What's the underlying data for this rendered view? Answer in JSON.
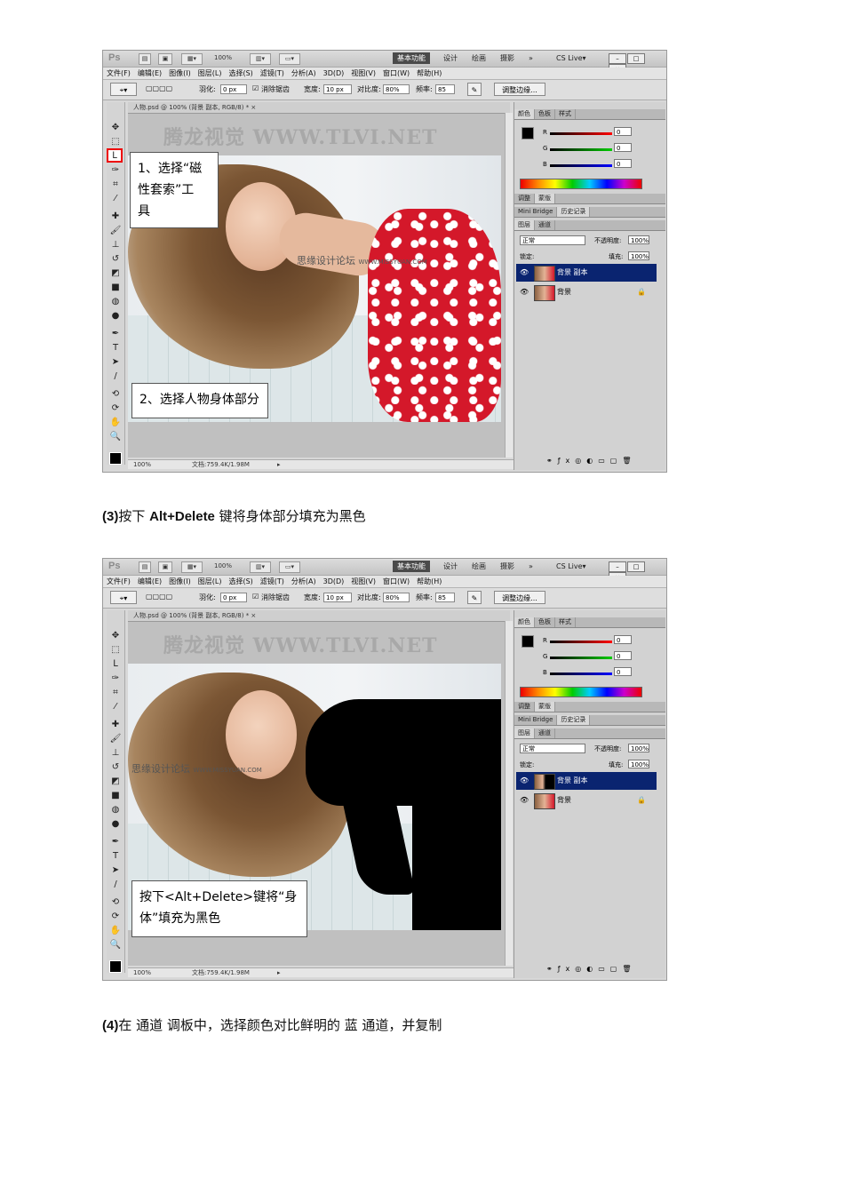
{
  "app": {
    "logo": "Ps",
    "zoom": "100%",
    "workspaces": [
      "基本功能",
      "设计",
      "绘画",
      "摄影",
      "»"
    ],
    "cs_live": "CS Live▾",
    "menu": [
      "文件(F)",
      "编辑(E)",
      "图像(I)",
      "图层(L)",
      "选择(S)",
      "滤镜(T)",
      "分析(A)",
      "3D(D)",
      "视图(V)",
      "窗口(W)",
      "帮助(H)"
    ],
    "options": {
      "feather_label": "羽化:",
      "feather_value": "0 px",
      "antialias_label": "消除锯齿",
      "width_label": "宽度:",
      "width_value": "10 px",
      "contrast_label": "对比度:",
      "contrast_value": "80%",
      "frequency_label": "频率:",
      "frequency_value": "85",
      "refine_edge": "调整边缘..."
    },
    "doc_tab": "人物.psd @ 100% (背景 副本, RGB/8) * ×",
    "watermark": "腾龙视觉 WWW.TLVI.NET",
    "site_watermark": "思缘设计论坛",
    "site_watermark_url": "WWW.MISSYUAN.COM",
    "status_zoom": "100%",
    "status_doc": "文档:759.4K/1.98M",
    "panels": {
      "color_tabs": [
        "颜色",
        "色板",
        "样式"
      ],
      "channels": [
        {
          "name": "R",
          "value": "0"
        },
        {
          "name": "G",
          "value": "0"
        },
        {
          "name": "B",
          "value": "0"
        }
      ],
      "adjust_tabs": [
        "调整",
        "蒙版"
      ],
      "history_tabs": [
        "Mini Bridge",
        "历史记录"
      ],
      "layer_tabs": [
        "图层",
        "通道"
      ],
      "blend_mode": "正常",
      "opacity_label": "不透明度:",
      "opacity_value": "100%",
      "lock_label": "锁定:",
      "fill_label": "填充:",
      "fill_value": "100%",
      "layers": [
        {
          "name": "背景 副本",
          "active": true
        },
        {
          "name": "背景",
          "active": false
        }
      ]
    }
  },
  "screenshot1": {
    "callout1": [
      "1、选择“磁",
      "性套索”工",
      "具"
    ],
    "callout2": "2、选择人物身体部分"
  },
  "caption3": {
    "num": "(3)",
    "pre": "按下 ",
    "key": "Alt+Delete",
    "post": " 键将身体部分填充为黑色"
  },
  "screenshot2": {
    "callout": [
      "按下<Alt+Delete>键将“身",
      "体”填充为黑色"
    ]
  },
  "caption4": {
    "num": "(4)",
    "text": "在 通道 调板中，选择颜色对比鲜明的 蓝 通道，并复制"
  }
}
